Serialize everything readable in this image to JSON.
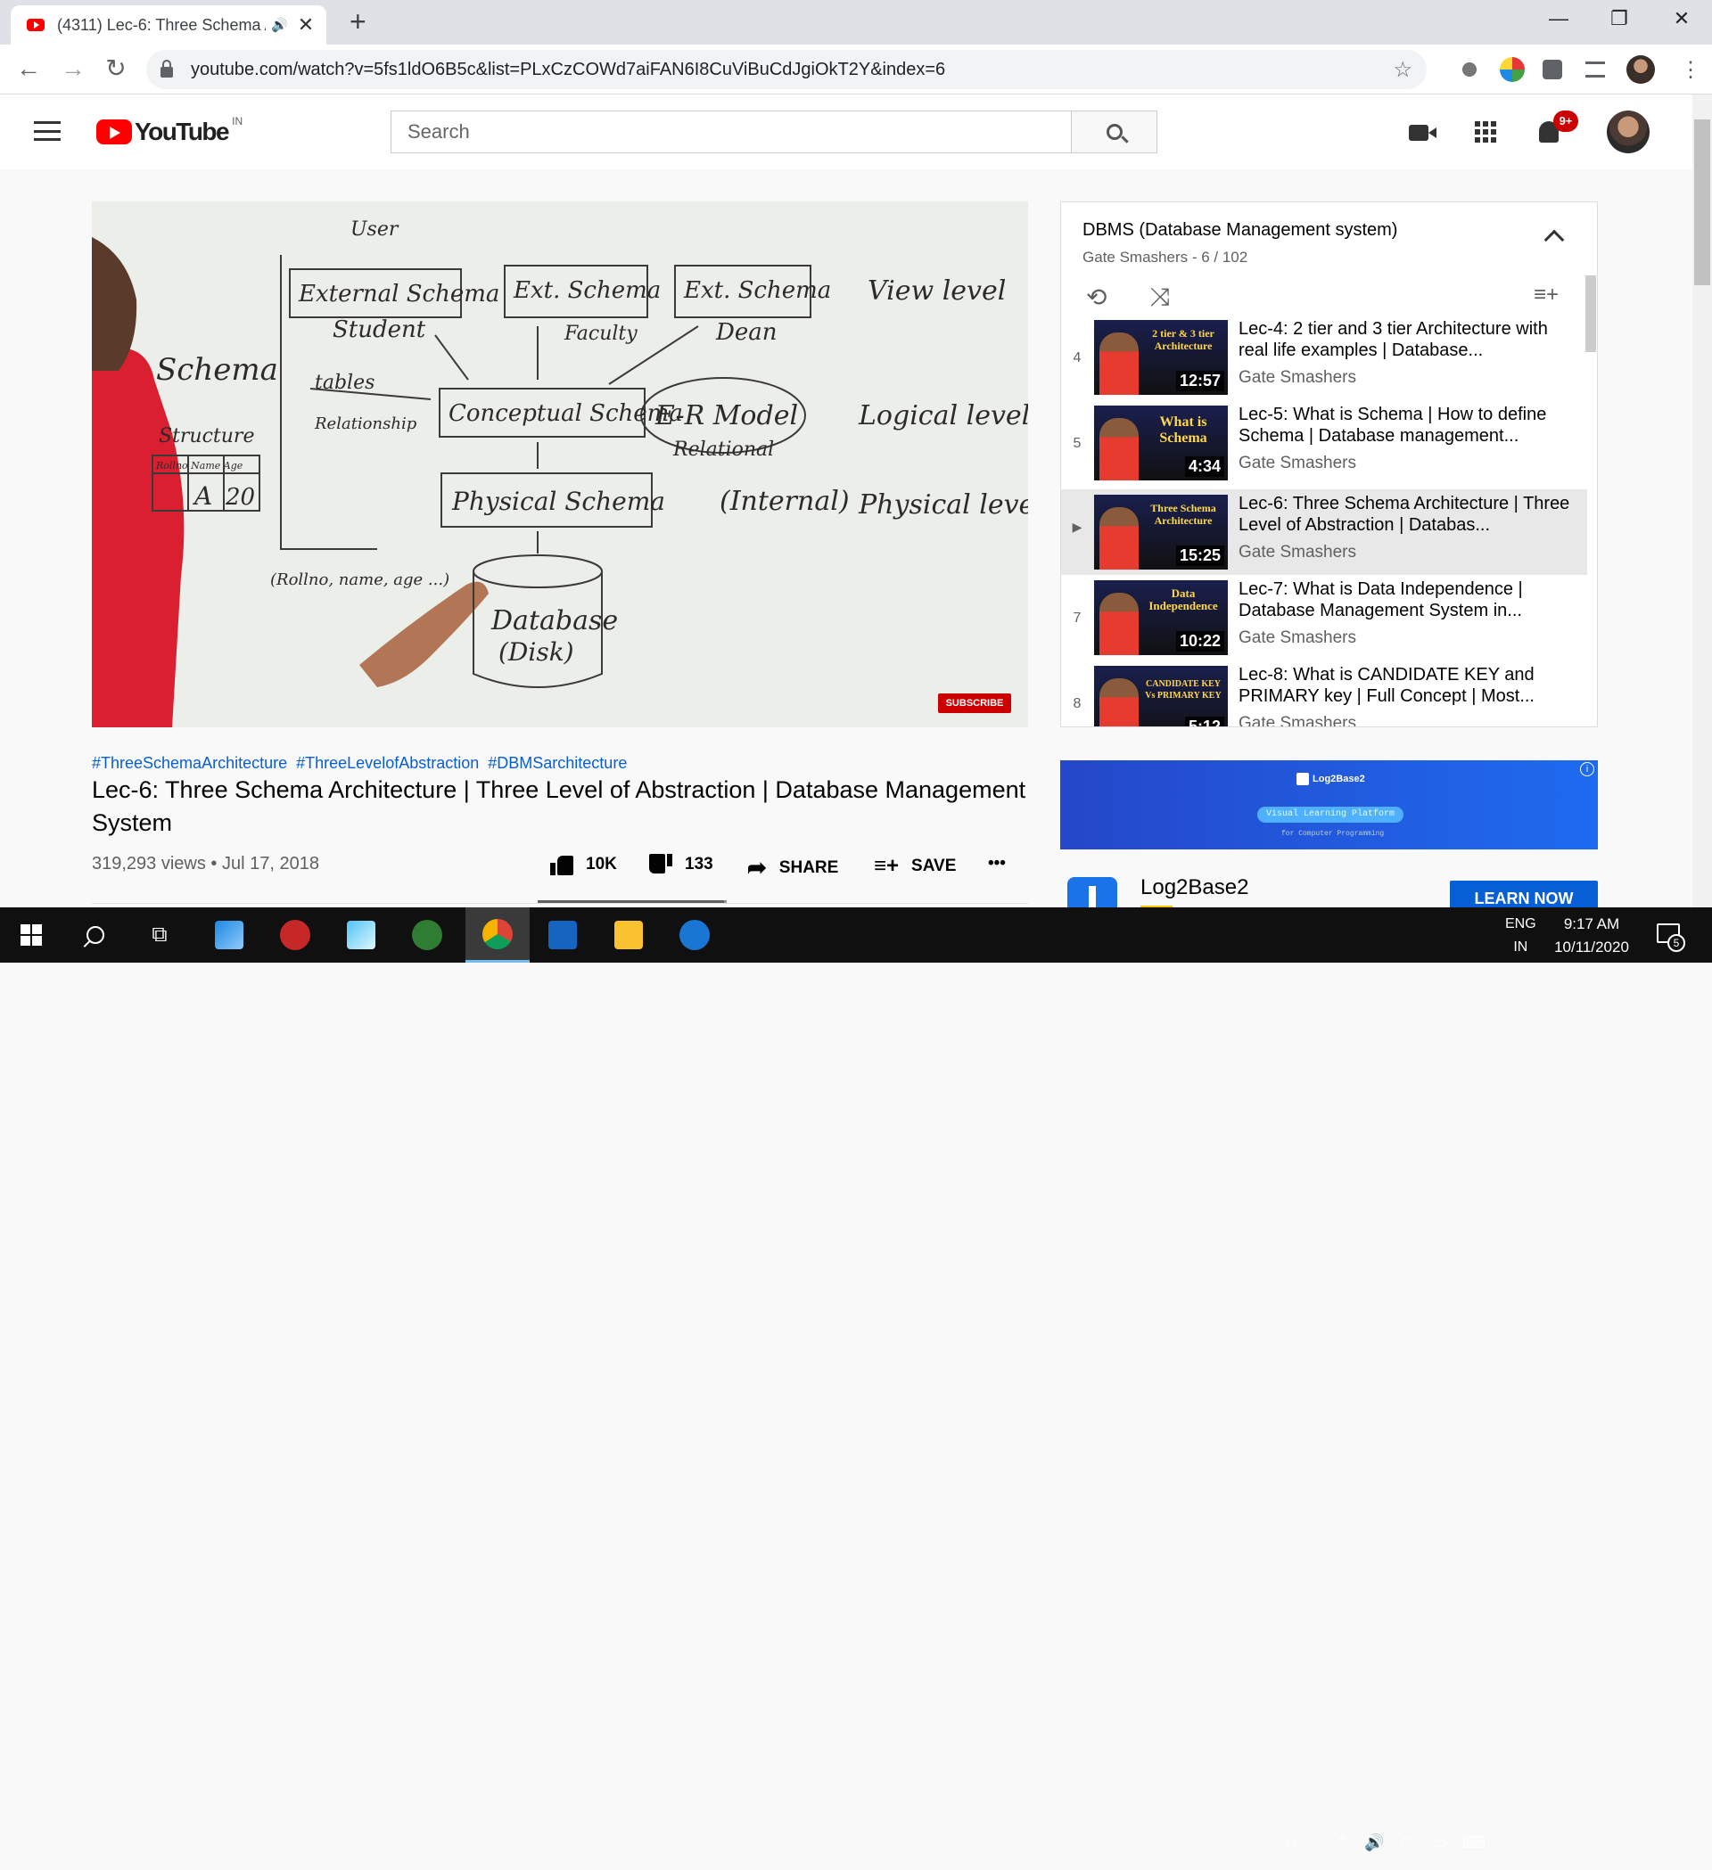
{
  "browser": {
    "tab_title": "(4311) Lec-6: Three Schema Architecture | Three Level of Abstraction",
    "new_tab": "+",
    "url": "youtube.com/watch?v=5fs1ldO6B5c&list=PLxCzCOWd7aiFAN6I8CuViBuCdJgiOkT2Y&index=6",
    "window_min": "—",
    "window_max": "❐",
    "window_close": "✕",
    "back": "←",
    "forward": "→",
    "reload": "↻",
    "tab_close": "✕",
    "speaker": "🔊",
    "bookmark": "☆"
  },
  "youtube": {
    "logo_text": "YouTube",
    "country": "IN",
    "search_placeholder": "Search",
    "notification_count": "9+"
  },
  "video": {
    "subscribe_watermark": "SUBSCRIBE",
    "hashtags": [
      "#ThreeSchemaArchitecture",
      "#ThreeLevelofAbstraction",
      "#DBMSarchitecture"
    ],
    "title": "Lec-6: Three Schema Architecture | Three Level of Abstraction | Database Management System",
    "views_date": "319,293 views • Jul 17, 2018",
    "likes": "10K",
    "dislikes": "133",
    "share": "SHARE",
    "save": "SAVE",
    "more": "•••",
    "like_ratio": 0.987,
    "whiteboard": {
      "user": "User",
      "external": "External Schema",
      "ext1": "Ext. Schema",
      "ext2": "Ext. Schema",
      "student": "Student",
      "faculty": "Faculty",
      "dean": "Dean",
      "view": "View level",
      "schema": "Schema",
      "structure": "Structure",
      "tables": "tables",
      "relationship": "Relationship",
      "conceptual": "Conceptual Schema",
      "er": "E-R Model",
      "relational": "Relational",
      "logical": "Logical level",
      "physical": "Physical Schema",
      "internal": "(Internal)",
      "physical_level": "Physical level",
      "database": "Database",
      "disk": "(Disk)",
      "rollno": "(Rollno, name, age ...)",
      "table_header": "Rollno Name Age",
      "a": "A",
      "twenty": "20"
    }
  },
  "playlist": {
    "title": "DBMS (Database Management system)",
    "subtitle": "Gate Smashers - 6 / 102",
    "loop": "⟲",
    "shuffle": "⤨",
    "add": "≡+",
    "items": [
      {
        "index": "4",
        "thumb_text": "2 tier & 3 tier Architecture",
        "duration": "12:57",
        "title": "Lec-4: 2 tier and 3 tier Architecture with real life examples | Database...",
        "channel": "Gate Smashers"
      },
      {
        "index": "5",
        "thumb_text": "What is Schema",
        "duration": "4:34",
        "title": "Lec-5: What is Schema | How to define Schema | Database management...",
        "channel": "Gate Smashers"
      },
      {
        "index": "▶",
        "thumb_text": "Three Schema Architecture",
        "duration": "15:25",
        "title": "Lec-6: Three Schema Architecture | Three Level of Abstraction | Databas...",
        "channel": "Gate Smashers"
      },
      {
        "index": "7",
        "thumb_text": "Data Independence",
        "duration": "10:22",
        "title": "Lec-7: What is Data Independence | Database Management System in...",
        "channel": "Gate Smashers"
      },
      {
        "index": "8",
        "thumb_text": "CANDIDATE KEY Vs PRIMARY KEY",
        "duration": "5:12",
        "title": "Lec-8: What is CANDIDATE KEY and PRIMARY key | Full Concept | Most...",
        "channel": "Gate Smashers"
      }
    ]
  },
  "ad": {
    "brand": "Log2Base2",
    "pill": "Visual Learning Platform",
    "tagline": "for Computer Programming",
    "info": "i",
    "advertiser": "Log2Base2",
    "cta": "LEARN NOW"
  },
  "taskbar": {
    "lang_top": "ENG",
    "lang_bottom": "IN",
    "time": "9:17 AM",
    "date": "10/11/2020",
    "notifications": "5"
  }
}
